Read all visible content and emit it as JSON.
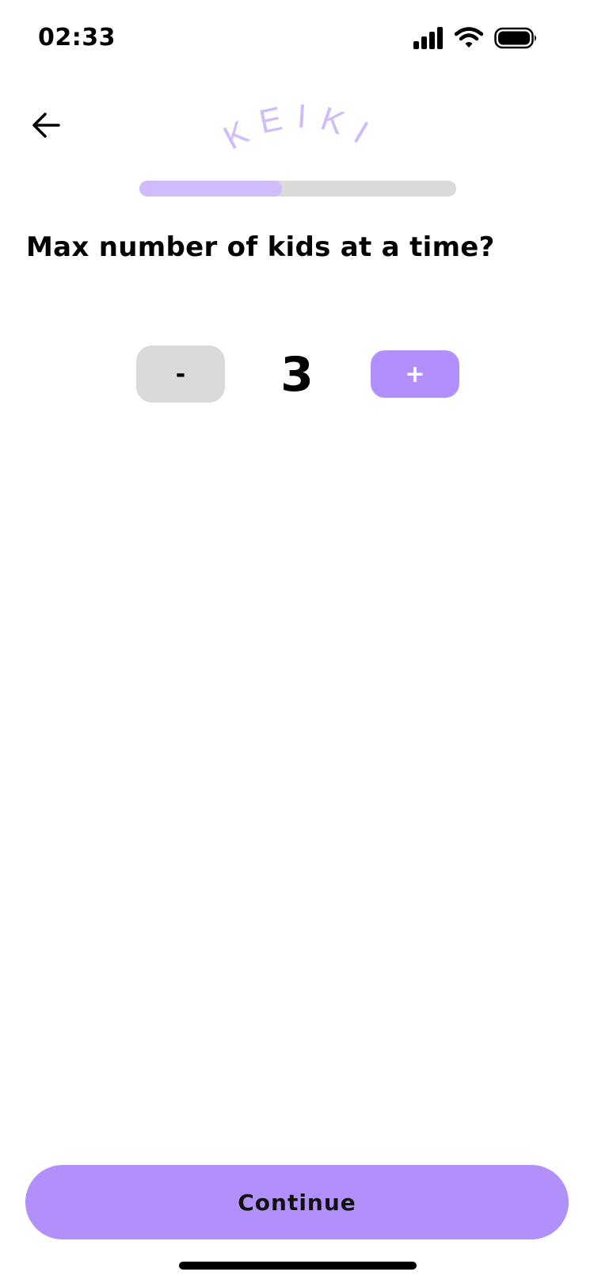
{
  "status_bar": {
    "time": "02:33"
  },
  "header": {
    "logo_text": "KEIKI"
  },
  "progress": {
    "fraction": 0.45,
    "fill_color": "#d0bcfb"
  },
  "question": "Max number of kids at a time?",
  "stepper": {
    "minus_label": "-",
    "value": "3",
    "plus_label": "+"
  },
  "continue_label": "Continue",
  "colors": {
    "accent": "#b190fc",
    "neutral": "#dadada",
    "logo": "#d0bcfb"
  },
  "icons": {
    "back": "arrow-left-icon",
    "signal": "signal-icon",
    "wifi": "wifi-icon",
    "battery": "battery-icon"
  }
}
